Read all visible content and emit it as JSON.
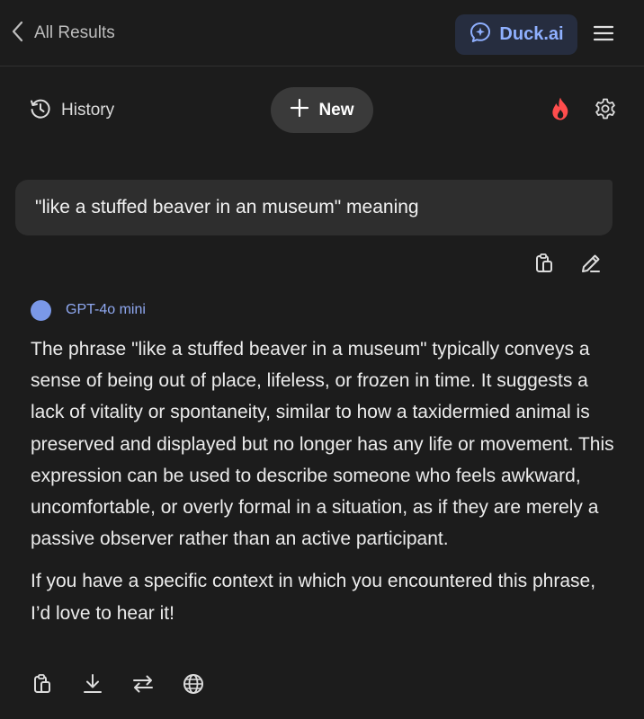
{
  "topbar": {
    "back_label": "All Results",
    "duck_label": "Duck.ai"
  },
  "toolbar": {
    "history_label": "History",
    "new_label": "New"
  },
  "conversation": {
    "user_message": "\"like a stuffed beaver in an museum\" meaning",
    "model_name": "GPT-4o mini",
    "answer_paragraphs": [
      "The phrase \"like a stuffed beaver in a museum\" typically conveys a sense of being out of place, lifeless, or frozen in time. It suggests a lack of vitality or spontaneity, similar to how a taxidermied animal is preserved and displayed but no longer has any life or movement. This expression can be used to describe someone who feels awkward, uncomfortable, or overly formal in a situation, as if they are merely a passive observer rather than an active participant.",
      "If you have a specific context in which you encountered this phrase, I’d love to hear it!"
    ]
  },
  "icons": {
    "back": "chevron-left-icon",
    "duck": "chat-sparkle-icon",
    "menu": "hamburger-menu-icon",
    "history": "history-clock-icon",
    "new": "plus-icon",
    "fire": "fire-icon",
    "settings": "gear-icon",
    "copy": "copy-icon",
    "edit": "pencil-icon",
    "download": "download-icon",
    "regenerate": "swap-arrows-icon",
    "web": "globe-icon"
  },
  "colors": {
    "background": "#1c1c1c",
    "accent": "#8fb0ff",
    "fire": "#ff4d4d",
    "model_dot": "#7a98e8"
  }
}
